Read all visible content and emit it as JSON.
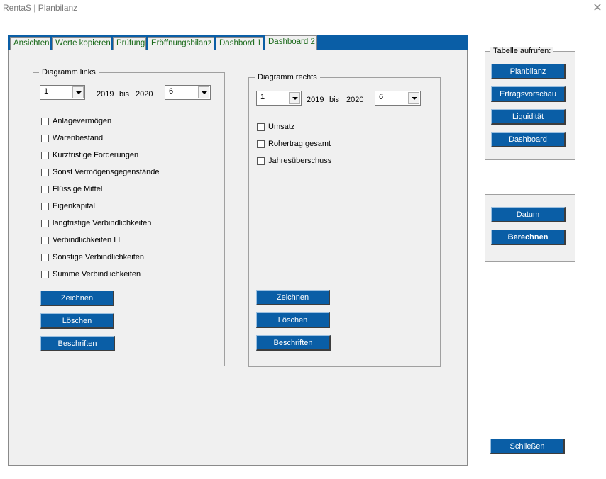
{
  "window": {
    "title": "RentaS | Planbilanz",
    "close_glyph": "✕"
  },
  "tabs": [
    {
      "label": "Ansichten"
    },
    {
      "label": "Werte kopieren"
    },
    {
      "label": "Prüfung"
    },
    {
      "label": "Eröffnungsbilanz"
    },
    {
      "label": "Dashbord 1"
    },
    {
      "label": "Dashboard 2"
    }
  ],
  "left_panel": {
    "legend": "Diagramm links",
    "from_combo_value": "1",
    "year_from": "2019",
    "bis": "bis",
    "year_to": "2020",
    "to_combo_value": "6",
    "checkboxes": [
      "Anlagevermögen",
      "Warenbestand",
      "Kurzfristige Forderungen",
      "Sonst Vermögensgegenstände",
      "Flüssige Mittel",
      "Eigenkapital",
      "langfristige Verbindlichkeiten",
      "Verbindlichkeiten LL",
      "Sonstige Verbindlichkeiten",
      "Summe Verbindlichkeiten"
    ],
    "buttons": {
      "draw": "Zeichnen",
      "delete": "Löschen",
      "label": "Beschriften"
    }
  },
  "right_panel": {
    "legend": "Diagramm rechts",
    "from_combo_value": "1",
    "year_from": "2019",
    "bis": "bis",
    "year_to": "2020",
    "to_combo_value": "6",
    "checkboxes": [
      "Umsatz",
      "Rohertrag gesamt",
      "Jahresüberschuss"
    ],
    "buttons": {
      "draw": "Zeichnen",
      "delete": "Löschen",
      "label": "Beschriften"
    }
  },
  "sidebar": {
    "legend": "Tabelle aufrufen:",
    "table_buttons": [
      "Planbilanz",
      "Ertragsvorschau",
      "Liquidität",
      "Dashboard"
    ],
    "date_button": "Datum",
    "calculate_button": "Berechnen",
    "close_button": "Schließen"
  }
}
